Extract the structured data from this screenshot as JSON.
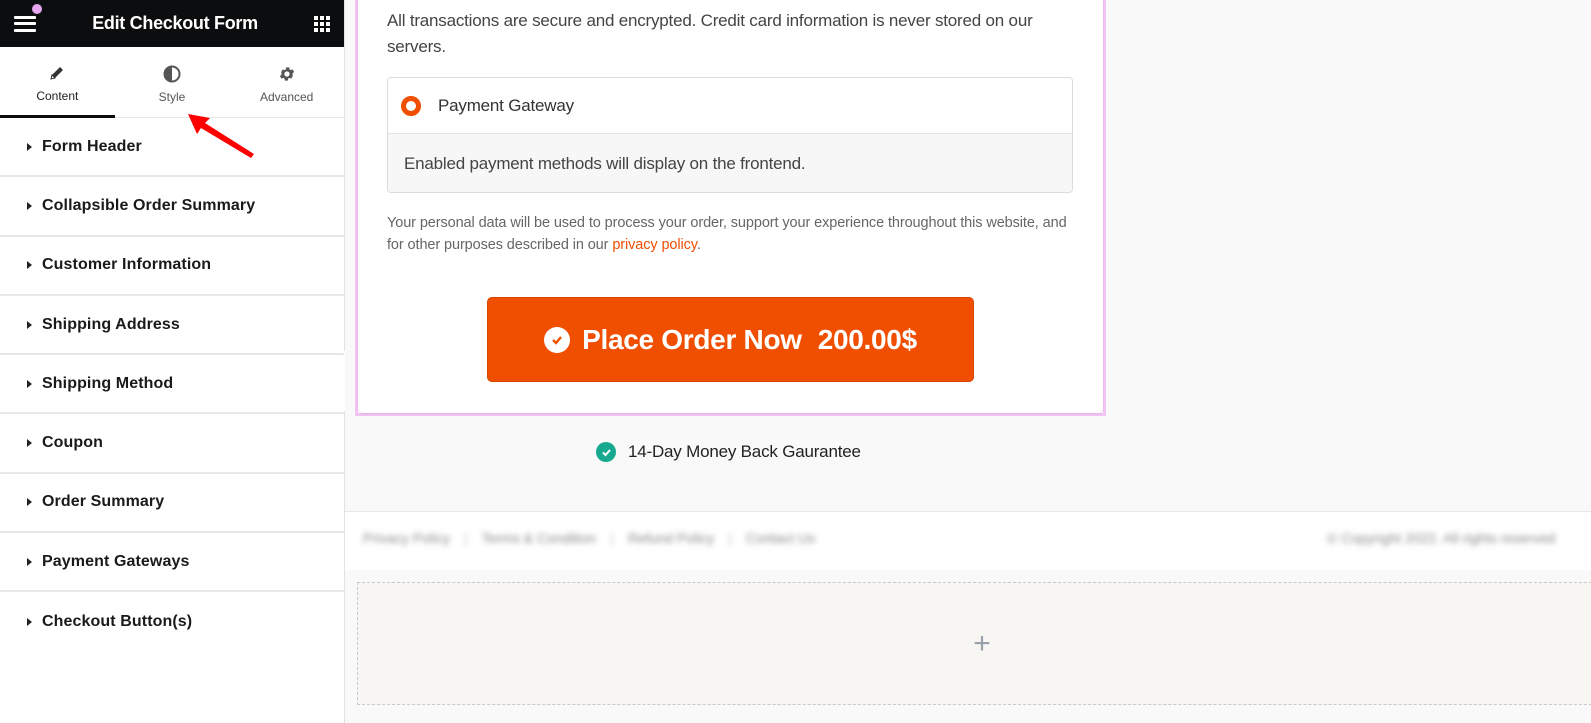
{
  "sidebar": {
    "title": "Edit Checkout Form",
    "tabs": [
      {
        "label": "Content",
        "icon": "pencil-icon",
        "active": true
      },
      {
        "label": "Style",
        "icon": "contrast-icon",
        "active": false
      },
      {
        "label": "Advanced",
        "icon": "gear-icon",
        "active": false
      }
    ],
    "sections": [
      {
        "label": "Form Header"
      },
      {
        "label": "Collapsible Order Summary"
      },
      {
        "label": "Customer Information"
      },
      {
        "label": "Shipping Address"
      },
      {
        "label": "Shipping Method"
      },
      {
        "label": "Coupon"
      },
      {
        "label": "Order Summary"
      },
      {
        "label": "Payment Gateways"
      },
      {
        "label": "Checkout Button(s)"
      }
    ]
  },
  "checkout": {
    "secure_text": "All transactions are secure and encrypted. Credit card information is never stored on our servers.",
    "payment_gateway_label": "Payment Gateway",
    "payment_gateway_note": "Enabled payment methods will display on the frontend.",
    "privacy_text_before": "Your personal data will be used to process your order, support your experience throughout this website, and for other purposes described in our ",
    "privacy_link": "privacy policy",
    "privacy_text_after": ".",
    "order_button_label": "Place Order Now",
    "order_button_price": "200.00$",
    "guarantee_text": "14-Day Money Back Gaurantee"
  },
  "footer": {
    "links": [
      "Privacy Policy",
      "Terms & Condition",
      "Refund Policy",
      "Contact Us"
    ],
    "copyright": "© Copyright 2022. All rights reserved"
  },
  "add_section": {
    "label": "+"
  },
  "colors": {
    "accent": "#f04e00",
    "guarantee_check": "#17a990",
    "selection_border": "#f2c3f5",
    "topbar": "#0c0d0e",
    "annotation_arrow": "#ff0000"
  }
}
